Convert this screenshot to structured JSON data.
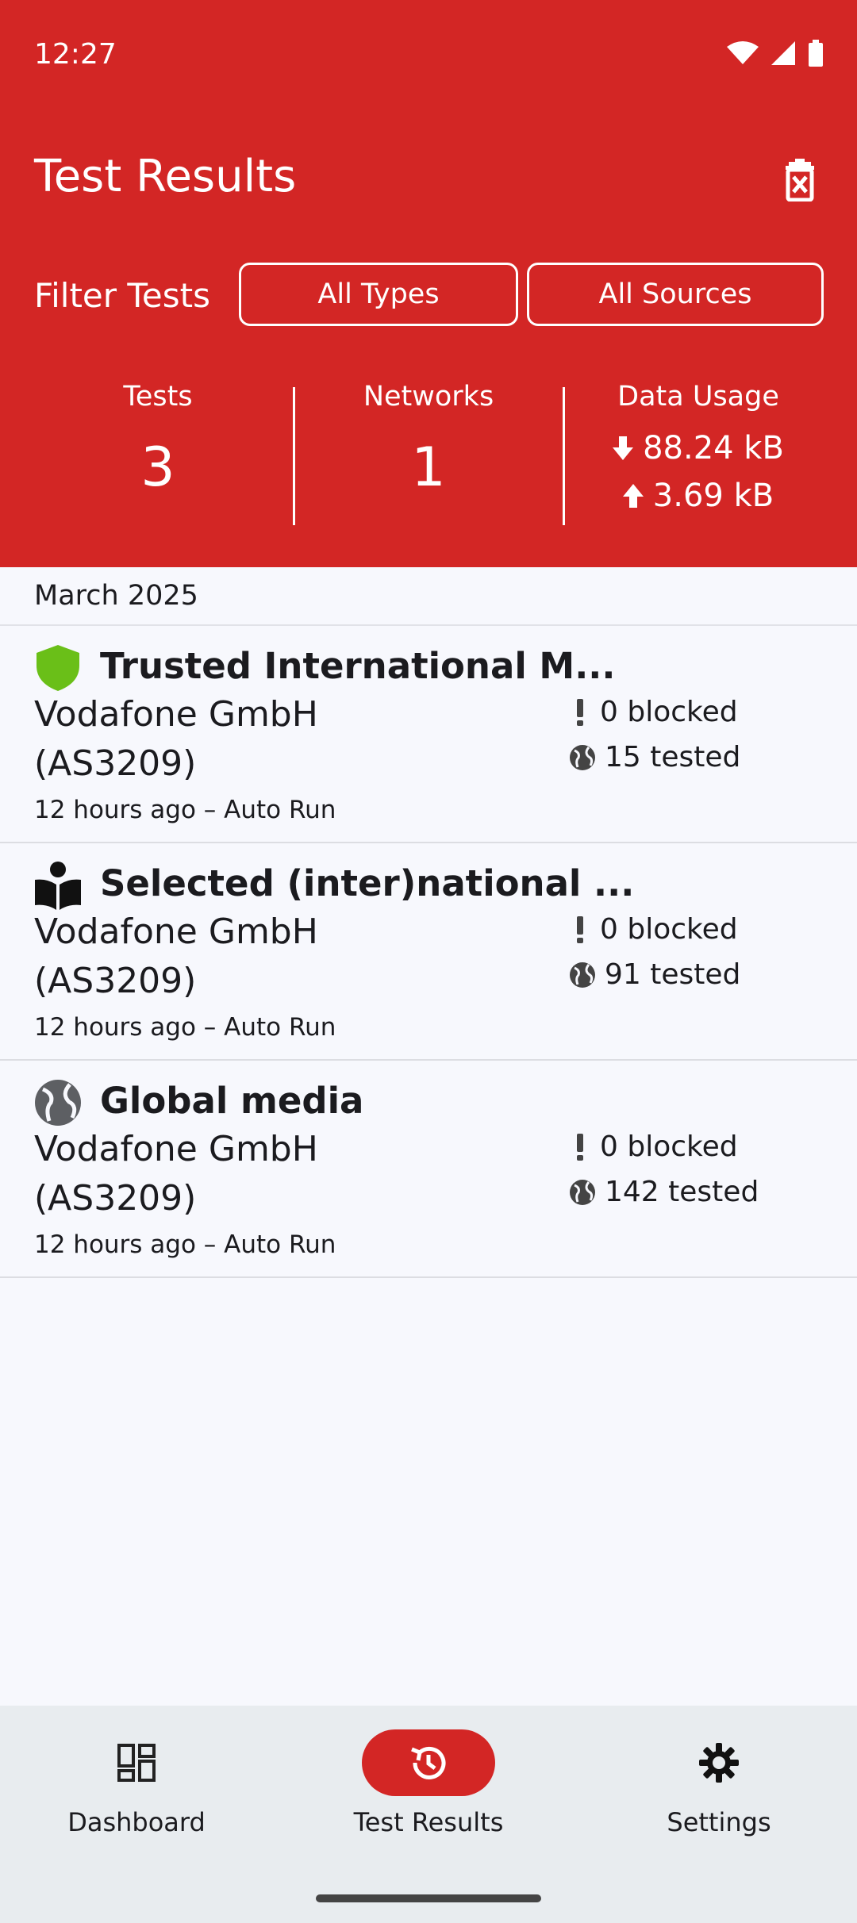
{
  "status": {
    "time": "12:27"
  },
  "header": {
    "title": "Test Results",
    "filter_label": "Filter Tests",
    "type_filter": "All Types",
    "source_filter": "All Sources"
  },
  "stats": {
    "tests_label": "Tests",
    "tests_value": "3",
    "networks_label": "Networks",
    "networks_value": "1",
    "data_label": "Data Usage",
    "download": "88.24 kB",
    "upload": "3.69 kB"
  },
  "month": "March 2025",
  "results": [
    {
      "title": "Trusted International M...",
      "network": "Vodafone GmbH",
      "asn": "(AS3209)",
      "meta": "12 hours ago – Auto Run",
      "blocked": "0 blocked",
      "tested": "15 tested",
      "icon": "shield-icon",
      "icon_color": "#6abf18"
    },
    {
      "title": "Selected (inter)national ...",
      "network": "Vodafone GmbH",
      "asn": "(AS3209)",
      "meta": "12 hours ago – Auto Run",
      "blocked": "0 blocked",
      "tested": "91 tested",
      "icon": "book-reader-icon"
    },
    {
      "title": "Global media",
      "network": "Vodafone GmbH",
      "asn": "(AS3209)",
      "meta": "12 hours ago – Auto Run",
      "blocked": "0 blocked",
      "tested": "142 tested",
      "icon": "globe-icon"
    }
  ],
  "nav": [
    {
      "label": "Dashboard",
      "icon": "dashboard-icon"
    },
    {
      "label": "Test Results",
      "icon": "history-icon",
      "active": true
    },
    {
      "label": "Settings",
      "icon": "gear-icon"
    }
  ],
  "colors": {
    "brand": "#d32625",
    "background": "#f7f8fd",
    "nav_background": "#e8ecef"
  }
}
